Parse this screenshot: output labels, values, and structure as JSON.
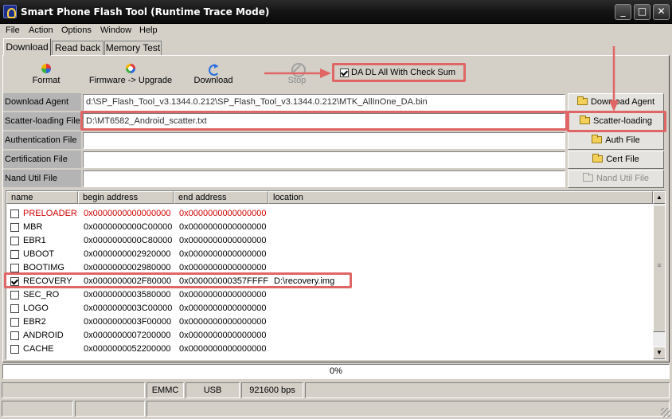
{
  "window": {
    "title": "Smart Phone Flash Tool (Runtime Trace Mode)",
    "minimize": "_",
    "maximize": "□",
    "close": "✕"
  },
  "menu": [
    "File",
    "Action",
    "Options",
    "Window",
    "Help"
  ],
  "tabs": [
    "Download",
    "Read back",
    "Memory Test"
  ],
  "toolbar": {
    "format": "Format",
    "firmware_upgrade": "Firmware -> Upgrade",
    "download": "Download",
    "stop": "Stop",
    "checksum_label": "DA DL All With Check Sum",
    "checksum_checked": true
  },
  "files": {
    "download_agent_label": "Download Agent",
    "download_agent_value": "d:\\SP_Flash_Tool_v3.1344.0.212\\SP_Flash_Tool_v3.1344.0.212\\MTK_AllInOne_DA.bin",
    "scatter_label": "Scatter-loading File",
    "scatter_value": "D:\\MT6582_Android_scatter.txt",
    "auth_label": "Authentication File",
    "auth_value": "",
    "cert_label": "Certification File",
    "cert_value": "",
    "nand_label": "Nand Util File",
    "nand_value": ""
  },
  "side_buttons": {
    "download_agent": "Download Agent",
    "scatter_loading": "Scatter-loading",
    "auth_file": "Auth File",
    "cert_file": "Cert File",
    "nand_util_file": "Nand Util File"
  },
  "list": {
    "columns": [
      "name",
      "begin address",
      "end address",
      "location"
    ],
    "rows": [
      {
        "name": "PRELOADER",
        "begin": "0x0000000000000000",
        "end": "0x0000000000000000",
        "location": "",
        "checked": false,
        "red": true
      },
      {
        "name": "MBR",
        "begin": "0x0000000000C00000",
        "end": "0x0000000000000000",
        "location": "",
        "checked": false,
        "red": false
      },
      {
        "name": "EBR1",
        "begin": "0x0000000000C80000",
        "end": "0x0000000000000000",
        "location": "",
        "checked": false,
        "red": false
      },
      {
        "name": "UBOOT",
        "begin": "0x0000000002920000",
        "end": "0x0000000000000000",
        "location": "",
        "checked": false,
        "red": false
      },
      {
        "name": "BOOTIMG",
        "begin": "0x0000000002980000",
        "end": "0x0000000000000000",
        "location": "",
        "checked": false,
        "red": false
      },
      {
        "name": "RECOVERY",
        "begin": "0x0000000002F80000",
        "end": "0x000000000357FFFF",
        "location": "D:\\recovery.img",
        "checked": true,
        "red": false
      },
      {
        "name": "SEC_RO",
        "begin": "0x0000000003580000",
        "end": "0x0000000000000000",
        "location": "",
        "checked": false,
        "red": false
      },
      {
        "name": "LOGO",
        "begin": "0x0000000003C00000",
        "end": "0x0000000000000000",
        "location": "",
        "checked": false,
        "red": false
      },
      {
        "name": "EBR2",
        "begin": "0x0000000003F00000",
        "end": "0x0000000000000000",
        "location": "",
        "checked": false,
        "red": false
      },
      {
        "name": "ANDROID",
        "begin": "0x0000000007200000",
        "end": "0x0000000000000000",
        "location": "",
        "checked": false,
        "red": false
      },
      {
        "name": "CACHE",
        "begin": "0x0000000052200000",
        "end": "0x0000000000000000",
        "location": "",
        "checked": false,
        "red": false
      }
    ]
  },
  "progress": {
    "text": "0%",
    "value": 0
  },
  "status": {
    "storage": "EMMC",
    "connection": "USB",
    "baud": "921600 bps"
  },
  "colors": {
    "annotation": "#e06565",
    "preloader_text": "#d00000"
  }
}
